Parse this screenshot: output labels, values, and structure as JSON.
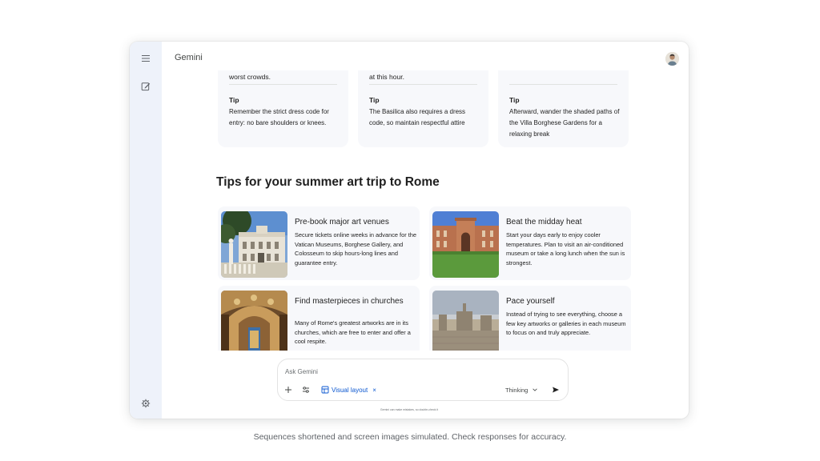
{
  "app": {
    "title": "Gemini"
  },
  "rail": {
    "menu_icon": "hamburger-menu-icon",
    "new_chat_icon": "edit-icon",
    "settings_icon": "gear-icon"
  },
  "top_cards": [
    {
      "fragment": "worst crowds.",
      "tip_label": "Tip",
      "tip_text": "Remember the strict dress code for entry: no bare shoulders or knees."
    },
    {
      "fragment": "at this hour.",
      "tip_label": "Tip",
      "tip_text": "The Basilica also requires a dress code, so maintain respectful attire"
    },
    {
      "fragment": "",
      "tip_label": "Tip",
      "tip_text": "Afterward, wander the shaded paths of the Villa Borghese Gardens for a relaxing break"
    }
  ],
  "section": {
    "title": "Tips for your summer art trip to Rome"
  },
  "tips": [
    {
      "title": "Pre-book major art venues",
      "body": "Secure tickets online weeks in advance for the Vatican Museums, Borghese Gallery, and Colosseum to skip hours-long lines and guarantee entry.",
      "image": "villa-medici-photo"
    },
    {
      "title": "Beat the midday heat",
      "body": "Start your days early to enjoy cooler temperatures. Plan to visit an air-conditioned museum or take a long lunch when the sun is strongest.",
      "image": "vatican-courtyard-photo"
    },
    {
      "title": "Find masterpieces in churches",
      "body": "Many of Rome's greatest artworks are in its churches, which are free to enter and offer a cool respite.",
      "image": "church-interior-photo"
    },
    {
      "title": "Pace yourself",
      "body": "Instead of trying to see everything, choose a few key artworks or galleries in each museum to focus on and truly appreciate.",
      "image": "piazza-photo"
    }
  ],
  "composer": {
    "placeholder": "Ask Gemini",
    "visual_layout_label": "Visual layout",
    "visual_layout_close": "×",
    "thinking_label": "Thinking"
  },
  "disclaimer": "Gemini can make mistakes, so double-check it",
  "footer_caption": "Sequences shortened and screen images simulated. Check responses for accuracy.",
  "colors": {
    "rail_bg": "#eef2fa",
    "card_bg": "#f7f8fb",
    "accent": "#0b57d0"
  }
}
